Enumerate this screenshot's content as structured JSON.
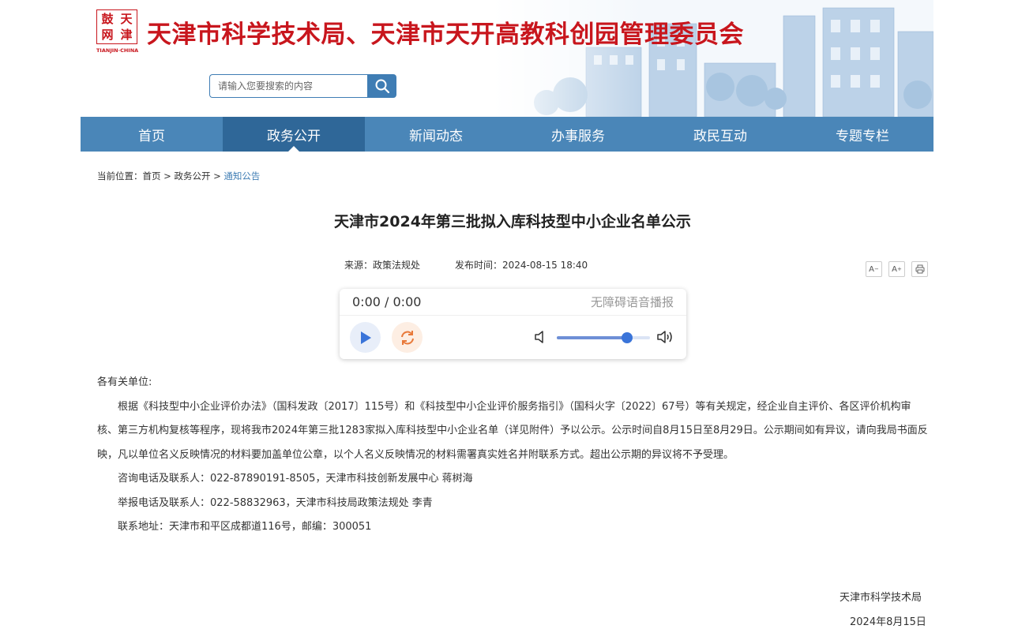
{
  "header": {
    "logo_chars": [
      "鼓",
      "天",
      "网",
      "津"
    ],
    "logo_en": "TIANJIN·CHINA",
    "site_title": "天津市科学技术局、天津市天开高教科创园管理委员会"
  },
  "search": {
    "placeholder": "请输入您要搜索的内容",
    "icon": "search-icon"
  },
  "nav": {
    "items": [
      {
        "label": "首页"
      },
      {
        "label": "政务公开"
      },
      {
        "label": "新闻动态"
      },
      {
        "label": "办事服务"
      },
      {
        "label": "政民互动"
      },
      {
        "label": "专题专栏"
      }
    ],
    "active_index": 1
  },
  "breadcrumb": {
    "prefix": "当前位置：",
    "items": [
      "首页",
      "政务公开",
      "通知公告"
    ],
    "separator": ">"
  },
  "article": {
    "title": "天津市2024年第三批拟入库科技型中小企业名单公示",
    "source": "来源：政策法规处",
    "publish_time": "发布时间：2024-08-15 18:40",
    "tools": {
      "font_decrease": "A",
      "font_increase": "A",
      "print_icon": "print-icon"
    }
  },
  "player": {
    "time": "0:00 / 0:00",
    "label": "无障碍语音播报",
    "volume": 0.75,
    "colors": {
      "accent": "#3a74d9",
      "loop": "#e8793a"
    }
  },
  "content": {
    "greeting": "各有关单位:",
    "paragraph": "根据《科技型中小企业评价办法》（国科发政〔2017〕115号）和《科技型中小企业评价服务指引》（国科火字〔2022〕67号）等有关规定，经企业自主评价、各区评价机构审核、第三方机构复核等程序，现将我市2024年第三批1283家拟入库科技型中小企业名单（详见附件）予以公示。公示时间自8月15日至8月29日。公示期间如有异议，请向我局书面反映，凡以单位名义反映情况的材料要加盖单位公章，以个人名义反映情况的材料需署真实姓名并附联系方式。超出公示期的异议将不予受理。",
    "consult": "咨询电话及联系人：022-87890191-8505，天津市科技创新发展中心 蒋树海",
    "report": "举报电话及联系人：022-58832963，天津市科技局政策法规处 李青",
    "address": "联系地址：天津市和平区成都道116号，邮编：300051"
  },
  "signature": {
    "org": "天津市科学技术局",
    "date": "2024年8月15日"
  },
  "colors": {
    "brand_red": "#c8161d",
    "nav_blue": "#4a86b8",
    "nav_active": "#2f6798",
    "link_blue": "#3f7db4"
  }
}
